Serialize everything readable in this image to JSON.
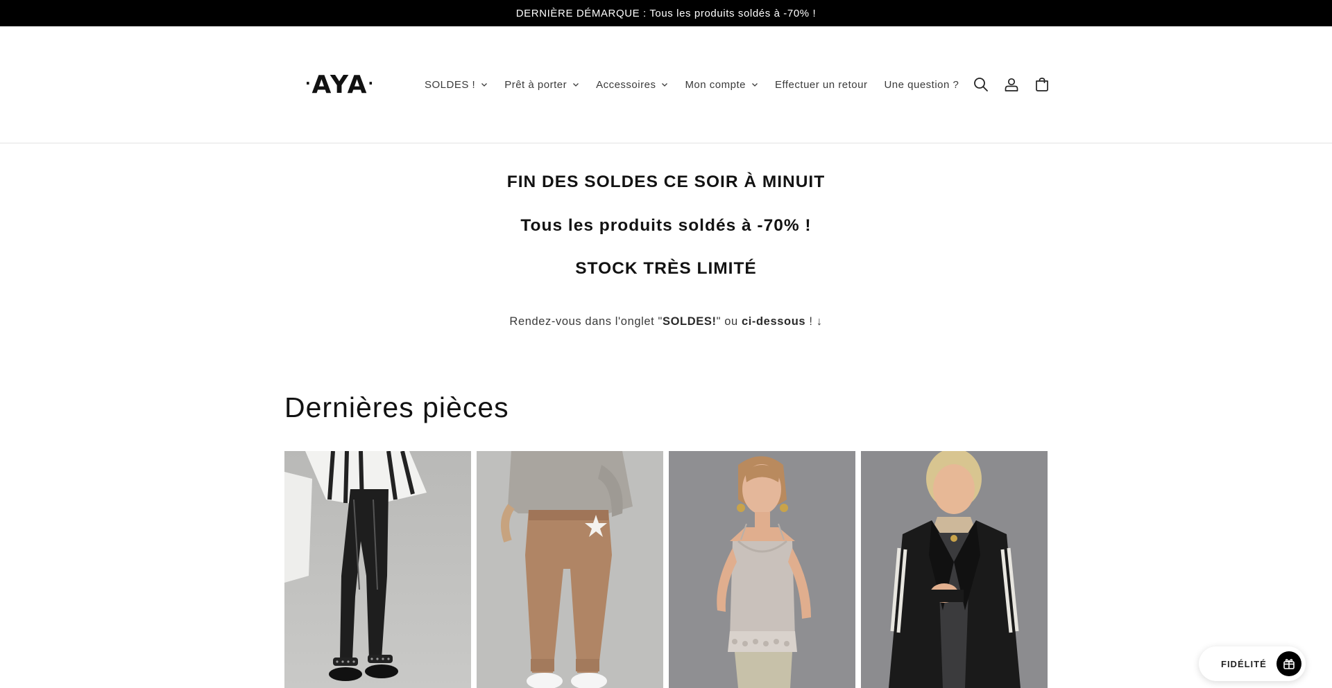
{
  "announcement": {
    "text": "DERNIÈRE DÉMARQUE : Tous les produits soldés à -70% !"
  },
  "header": {
    "logo_text": "AYA",
    "nav": [
      {
        "label": "SOLDES !",
        "has_dropdown": true
      },
      {
        "label": "Prêt à porter",
        "has_dropdown": true
      },
      {
        "label": "Accessoires",
        "has_dropdown": true
      },
      {
        "label": "Mon compte",
        "has_dropdown": true
      },
      {
        "label": "Effectuer un retour",
        "has_dropdown": false
      },
      {
        "label": "Une question ?",
        "has_dropdown": false
      }
    ],
    "icons": [
      "search-icon",
      "account-icon",
      "cart-icon"
    ]
  },
  "hero": {
    "line1": "FIN DES SOLDES CE SOIR À MINUIT",
    "line2": "Tous les produits soldés à -70% !",
    "line3": "STOCK TRÈS LIMITÉ",
    "sub_prefix": "Rendez-vous dans l'onglet \"",
    "sub_bold1": "SOLDES!",
    "sub_middle": "\" ou ",
    "sub_bold2": "ci-dessous",
    "sub_suffix": " ! ↓"
  },
  "collection": {
    "title": "Dernières pièces",
    "products": [
      {
        "image": "black-leather-leggings-sandals"
      },
      {
        "image": "camel-star-jogger-pants"
      },
      {
        "image": "beige-lace-camisole"
      },
      {
        "image": "black-striped-blazer"
      }
    ]
  },
  "loyalty": {
    "label": "FIDÉLITÉ",
    "icon": "gift-icon"
  },
  "colors": {
    "announcement_bg": "#000000",
    "text": "#121212",
    "muted": "#3a3a3a"
  }
}
